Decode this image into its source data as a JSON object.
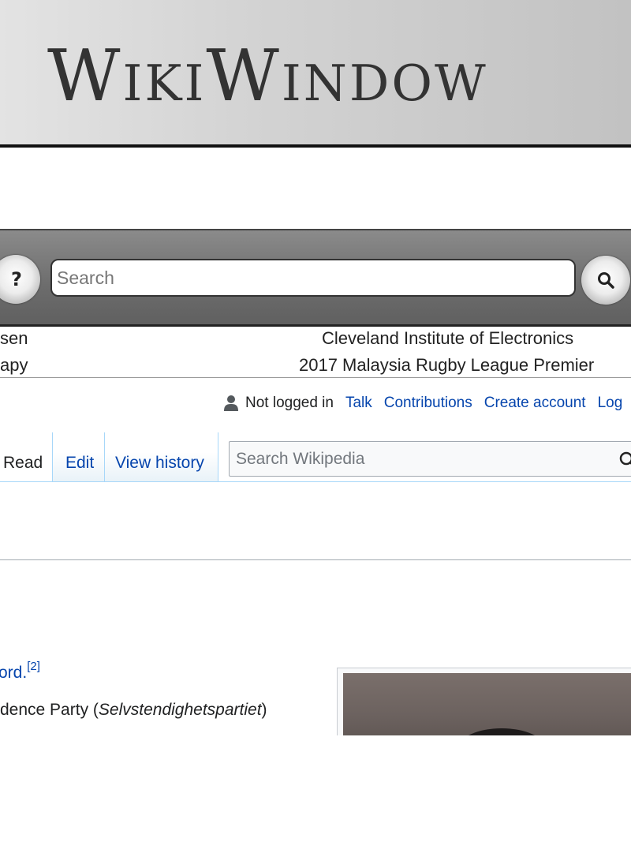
{
  "banner": {
    "logo_text": "WikiWindow"
  },
  "search_bar": {
    "placeholder": "Search",
    "help_label": "?"
  },
  "random_links": {
    "left": [
      "sen",
      "apy"
    ],
    "right": [
      "Cleveland Institute of Electronics",
      "2017 Malaysia Rugby League Premier"
    ]
  },
  "user_bar": {
    "status": "Not logged in",
    "links": [
      "Talk",
      "Contributions",
      "Create account",
      "Log"
    ]
  },
  "tabs": {
    "read": "Read",
    "edit": "Edit",
    "history": "View history"
  },
  "wiki_search": {
    "placeholder": "Search Wikipedia"
  },
  "article": {
    "line1_link": "ord.",
    "line1_ref": "[2]",
    "line2_prefix": "dence Party (",
    "line2_italic": "Selvstendighetspartiet",
    "line2_suffix": ")"
  },
  "colors": {
    "link": "#0645ad",
    "tab_border": "#a7d7f9"
  },
  "icons": [
    "help-icon",
    "search-icon",
    "user-icon"
  ]
}
